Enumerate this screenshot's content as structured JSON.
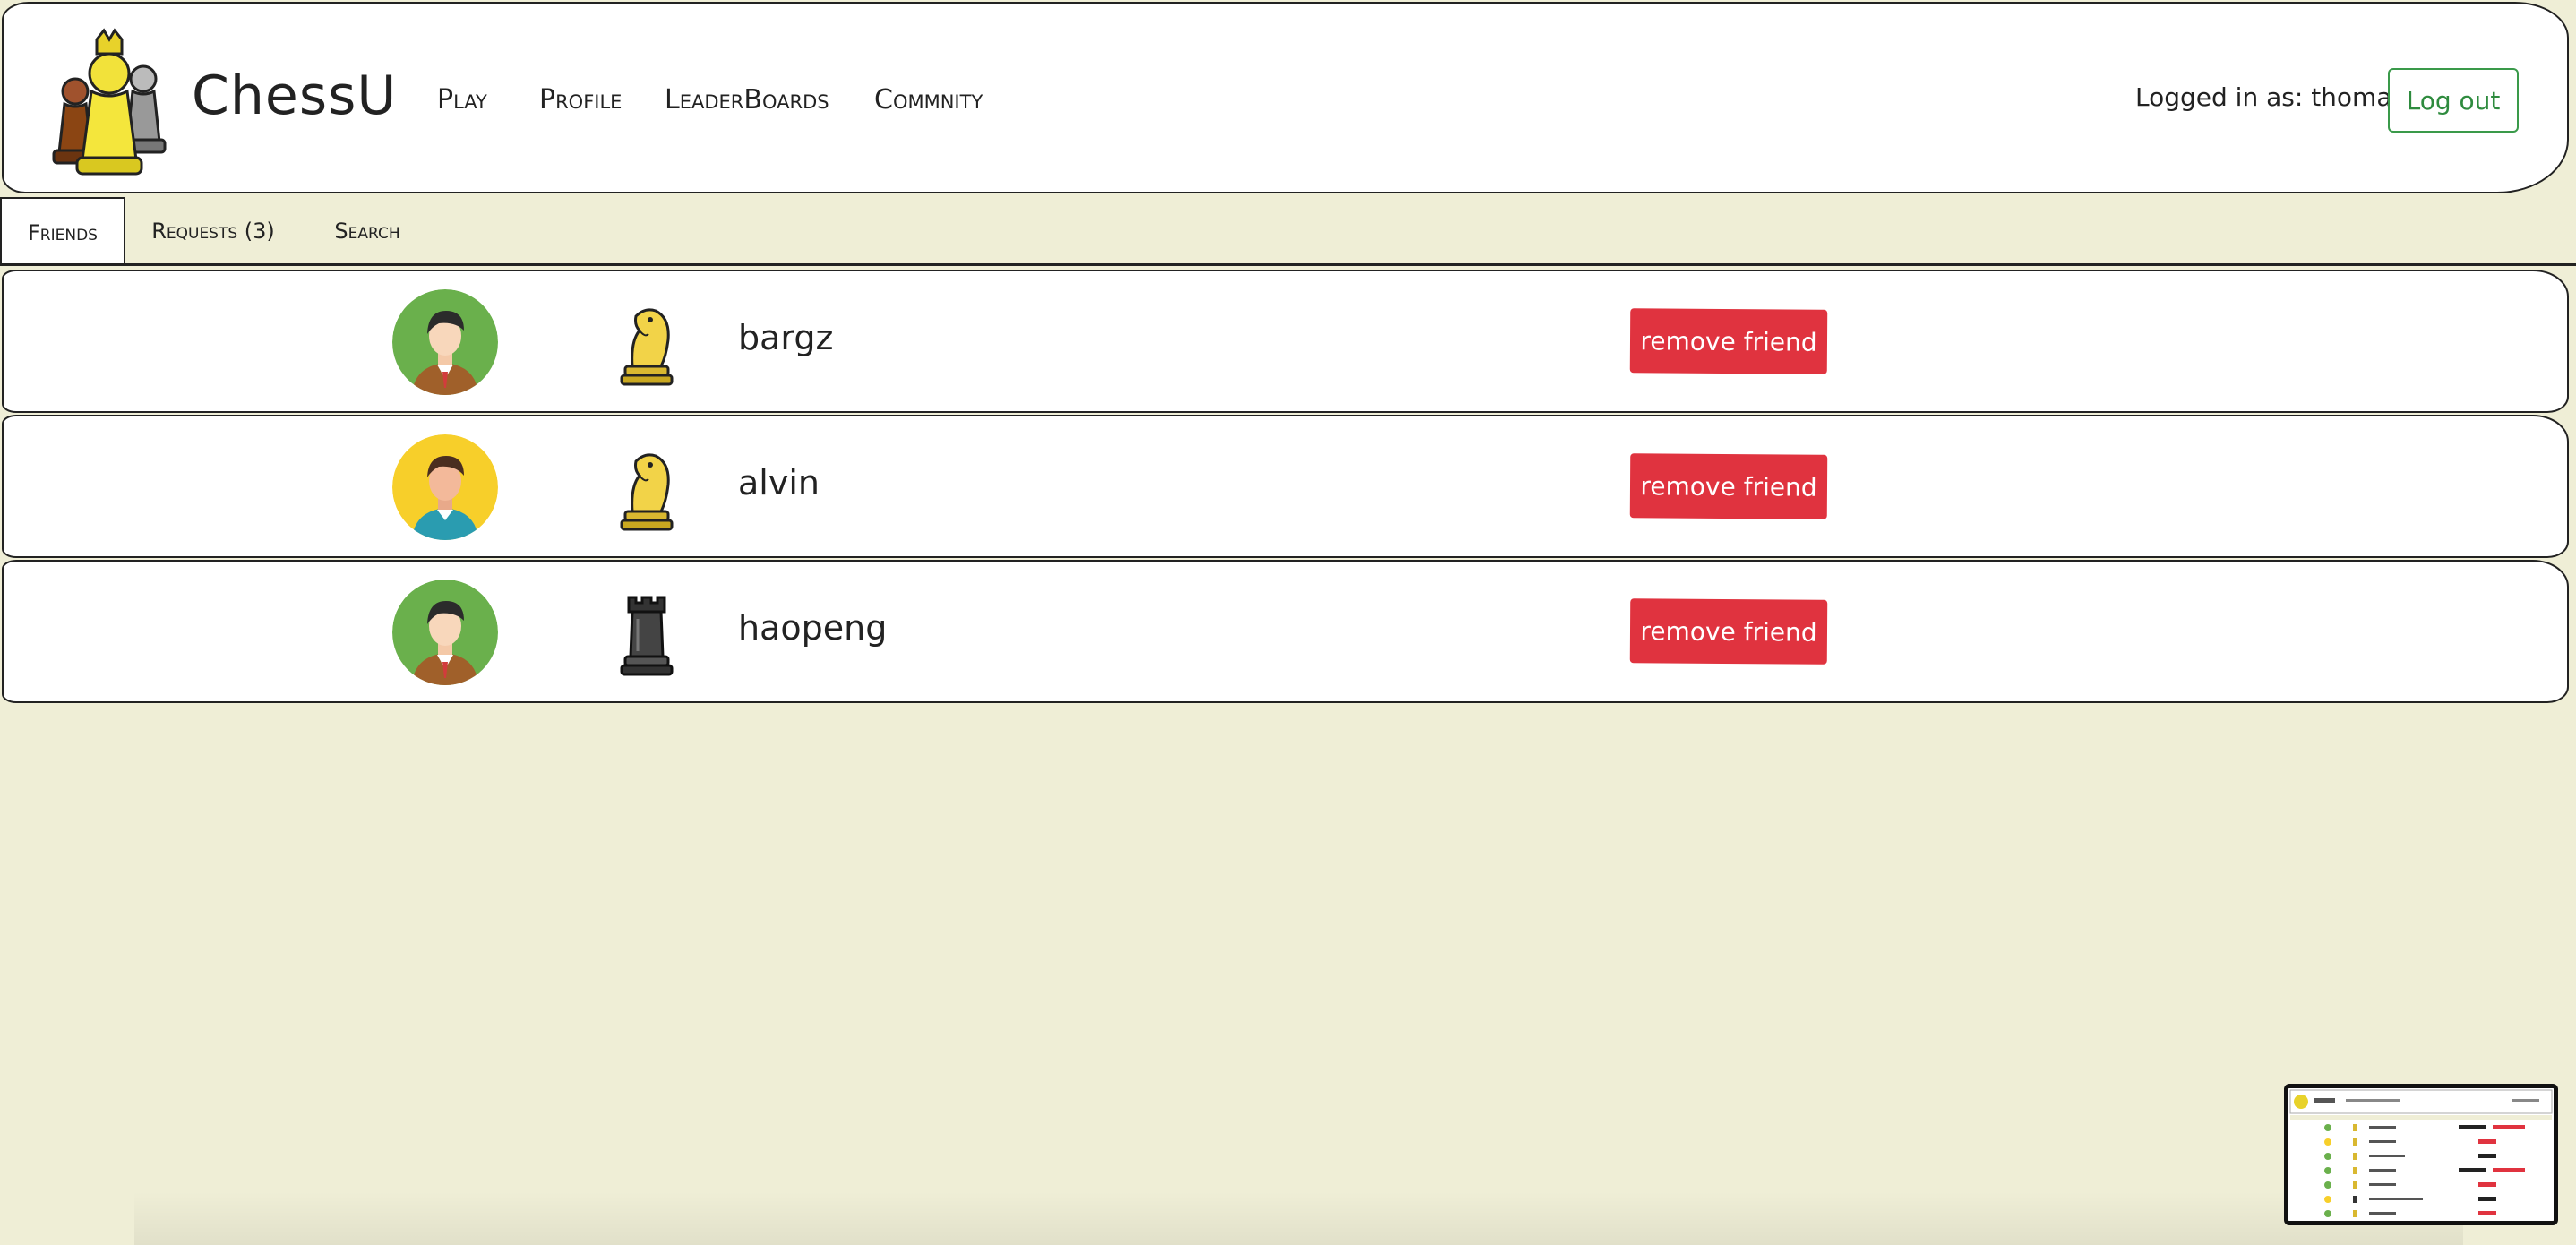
{
  "header": {
    "brand": "ChessU",
    "nav": [
      "Play",
      "Profile",
      "LeaderBoards",
      "Commnity"
    ],
    "login_text": "Logged in as: thomas",
    "logout_label": "Log out"
  },
  "tabs": [
    {
      "label": "Friends",
      "active": true
    },
    {
      "label": "Requests (3)",
      "active": false
    },
    {
      "label": "Search",
      "active": false
    }
  ],
  "friends": [
    {
      "username": "bargz",
      "avatar": "green-avatar-icon",
      "piece": "gold-knight-icon",
      "action": "remove friend"
    },
    {
      "username": "alvin",
      "avatar": "yellow-avatar-icon",
      "piece": "gold-knight-icon",
      "action": "remove friend"
    },
    {
      "username": "haopeng",
      "avatar": "green-avatar-icon",
      "piece": "black-rook-icon",
      "action": "remove friend"
    }
  ],
  "colors": {
    "background": "#efeed6",
    "remove_button": "#e0333f",
    "logout_border": "#3a9a4a"
  }
}
